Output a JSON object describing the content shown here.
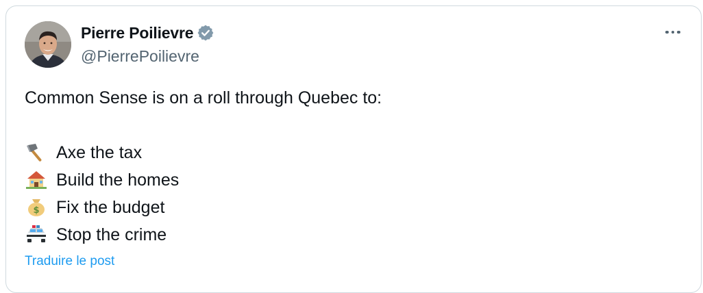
{
  "author": {
    "display_name": "Pierre Poilievre",
    "handle": "@PierrePoilievre",
    "verified_icon": "verified-badge-icon",
    "avatar": "avatar"
  },
  "menu": {
    "more_icon": "more-options-icon"
  },
  "tweet": {
    "intro": "Common Sense is on a roll through Quebec to:",
    "items": [
      {
        "icon": "axe-icon",
        "text": "Axe the tax"
      },
      {
        "icon": "house-icon",
        "text": "Build the homes"
      },
      {
        "icon": "money-bag-icon",
        "text": "Fix the budget"
      },
      {
        "icon": "police-car-icon",
        "text": "Stop the crime"
      }
    ]
  },
  "translate_label": "Traduire le post",
  "colors": {
    "text": "#0f1419",
    "secondary": "#536471",
    "link": "#1d9bf0",
    "border": "#cfd9de"
  }
}
